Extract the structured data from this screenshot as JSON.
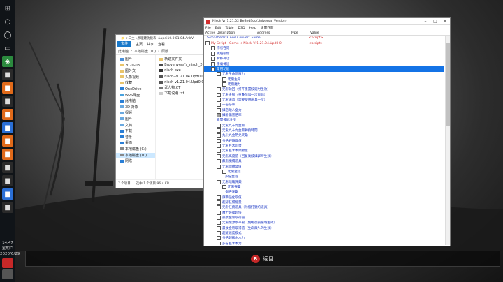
{
  "taskbar": {
    "icons": [
      "windows-icon",
      "search-icon",
      "cortana-icon",
      "task-view-icon",
      "gamebar-icon",
      "app-icon",
      "app-icon",
      "app-icon",
      "app-icon",
      "app-icon",
      "app-icon",
      "app-icon",
      "app-icon",
      "app-icon",
      "app-icon",
      "app-icon"
    ],
    "clock_time": "14:47",
    "clock_weekday": "星期六",
    "clock_date": "2020/6/29"
  },
  "explorer": {
    "title": "| 📁 ▾ 二主→原理建功能表→Lupdi10.0.01.04.AnbV",
    "ribbon": [
      "文件",
      "主页",
      "共享",
      "查看"
    ],
    "address": [
      "此电脑",
      "本地磁盘 (D:)",
      "原版"
    ],
    "nav": [
      "图片",
      "2020-08",
      "国外文",
      "头像视频",
      "收藏",
      "OneDrive",
      "WPS网盘",
      "此电脑",
      "3D 对象",
      "视频",
      "图片",
      "文档",
      "下载",
      "音乐",
      "桌面",
      "本地磁盘 (C:)",
      "本地磁盘 (D:)",
      "网络"
    ],
    "nav_selected": 16,
    "files": [
      "新建文件夹",
      "Bruyenyera's_nisch_2019",
      "nisch.exe",
      "nisch-v1.21.04.Upd0.0.",
      "nisch-v1.21.04.Upd0.0.",
      "武人物.CT",
      "下载说明.txt"
    ],
    "status_items": "7 个项目",
    "status_selected": "选中 1 个项目  96.4 KB"
  },
  "nisch": {
    "title": "Nisch Vr 1.21.02 BeBedEgg(Universal Version)",
    "menu": [
      "File",
      "Edit",
      "Table",
      "D3D",
      "Help",
      "设置界面"
    ],
    "columns": [
      "Active",
      "Description",
      "Address",
      "Type",
      "Value"
    ],
    "rows": [
      {
        "text": "Simplified CE And Convert Game",
        "indent": 5,
        "cb": false,
        "color": "blue",
        "value": "<script>"
      },
      {
        "text": "My Script - Game is Nisch Vr1.21.04.Upd0.0",
        "indent": 2,
        "cb": true,
        "color": "red",
        "value": "<script>"
      },
      {
        "text": "作者在周",
        "indent": 10,
        "cb": true,
        "color": "blue",
        "value": ""
      },
      {
        "text": "跳越剧情",
        "indent": 10,
        "cb": true,
        "color": "blue",
        "value": ""
      },
      {
        "text": "瞬移神功",
        "indent": 10,
        "cb": true,
        "color": "blue",
        "value": ""
      },
      {
        "text": "重複傳送",
        "indent": 10,
        "cb": true,
        "color": "blue",
        "value": ""
      },
      {
        "text": "常用功能",
        "indent": 10,
        "cb": true,
        "color": "blue",
        "value": "",
        "selected": true
      },
      {
        "text": "无限生命与魔力",
        "indent": 18,
        "cb": true,
        "color": "blue",
        "value": ""
      },
      {
        "text": "无限生命",
        "indent": 26,
        "cb": true,
        "color": "blue",
        "value": ""
      },
      {
        "text": "无限魔力",
        "indent": 26,
        "cb": true,
        "color": "blue",
        "value": ""
      },
      {
        "text": "无限轮回（打开重置按鈕时生效）",
        "indent": 18,
        "cb": true,
        "color": "blue",
        "value": ""
      },
      {
        "text": "无限金钱（重叠前加一次资源）",
        "indent": 18,
        "cb": true,
        "color": "blue",
        "value": ""
      },
      {
        "text": "无限道具（需要使用道具一次）",
        "indent": 18,
        "cb": true,
        "color": "blue",
        "value": ""
      },
      {
        "text": "一击必杀",
        "indent": 18,
        "cb": true,
        "color": "blue",
        "value": ""
      },
      {
        "text": "攝空敵人全力",
        "indent": 18,
        "cb": true,
        "color": "blue",
        "value": ""
      },
      {
        "text": "攝敵傷害倍率",
        "indent": 18,
        "cb": true,
        "color": "blue",
        "value": ""
      },
      {
        "text": "瞬間技能冷卻",
        "indent": 18,
        "cb": false,
        "color": "blue",
        "value": ""
      },
      {
        "text": "无限九十九金幣",
        "indent": 18,
        "cb": true,
        "color": "blue",
        "value": ""
      },
      {
        "text": "无限九十九金幣轉換時間",
        "indent": 18,
        "cb": true,
        "color": "blue",
        "value": ""
      },
      {
        "text": "九十九金幣兑奖勵",
        "indent": 18,
        "cb": true,
        "color": "blue",
        "value": ""
      },
      {
        "text": "多倍經驗取值",
        "indent": 18,
        "cb": true,
        "color": "blue",
        "value": ""
      },
      {
        "text": "无限巨木可發",
        "indent": 18,
        "cb": true,
        "color": "blue",
        "value": ""
      },
      {
        "text": "无限巨木木頭數量",
        "indent": 18,
        "cb": true,
        "color": "blue",
        "value": ""
      },
      {
        "text": "无限高度值（回复後被攝擊時生效）",
        "indent": 18,
        "cb": true,
        "color": "blue",
        "value": ""
      },
      {
        "text": "無限魔價道具",
        "indent": 18,
        "cb": true,
        "color": "blue",
        "value": ""
      },
      {
        "text": "无限魂體盛值",
        "indent": 18,
        "cb": true,
        "color": "blue",
        "value": ""
      },
      {
        "text": "无限金錢",
        "indent": 26,
        "cb": true,
        "color": "blue",
        "value": ""
      },
      {
        "text": "多倍金錢",
        "indent": 30,
        "cb": false,
        "color": "blue",
        "value": ""
      },
      {
        "text": "无限魂魄彈藥",
        "indent": 18,
        "cb": true,
        "color": "blue",
        "value": ""
      },
      {
        "text": "无限彈藥",
        "indent": 26,
        "cb": true,
        "color": "blue",
        "value": ""
      },
      {
        "text": "多倍彈藥",
        "indent": 30,
        "cb": false,
        "color": "blue",
        "value": ""
      },
      {
        "text": "彈藥強化取值",
        "indent": 18,
        "cb": true,
        "color": "blue",
        "value": ""
      },
      {
        "text": "超級裝備能量",
        "indent": 18,
        "cb": true,
        "color": "blue",
        "value": ""
      },
      {
        "text": "无限任務道具（除僱打獵的道具）",
        "indent": 18,
        "cb": true,
        "color": "blue",
        "value": ""
      },
      {
        "text": "魔力恢復超快",
        "indent": 18,
        "cb": true,
        "color": "blue",
        "value": ""
      },
      {
        "text": "最後金幣取得值",
        "indent": 18,
        "cb": true,
        "color": "blue",
        "value": ""
      },
      {
        "text": "无限能源水平限（使用後被僱時生效）",
        "indent": 18,
        "cb": true,
        "color": "blue",
        "value": ""
      },
      {
        "text": "最後金幣取得值（生命敵人的生效）",
        "indent": 18,
        "cb": true,
        "color": "blue",
        "value": ""
      },
      {
        "text": "超級速度模式",
        "indent": 18,
        "cb": true,
        "color": "blue",
        "value": ""
      },
      {
        "text": "多倍超級木木力",
        "indent": 18,
        "cb": true,
        "color": "blue",
        "value": ""
      },
      {
        "text": "多倍巨木木力",
        "indent": 18,
        "cb": true,
        "color": "blue",
        "value": ""
      }
    ]
  },
  "bottombar": {
    "button_glyph": "B",
    "label": "返回"
  }
}
